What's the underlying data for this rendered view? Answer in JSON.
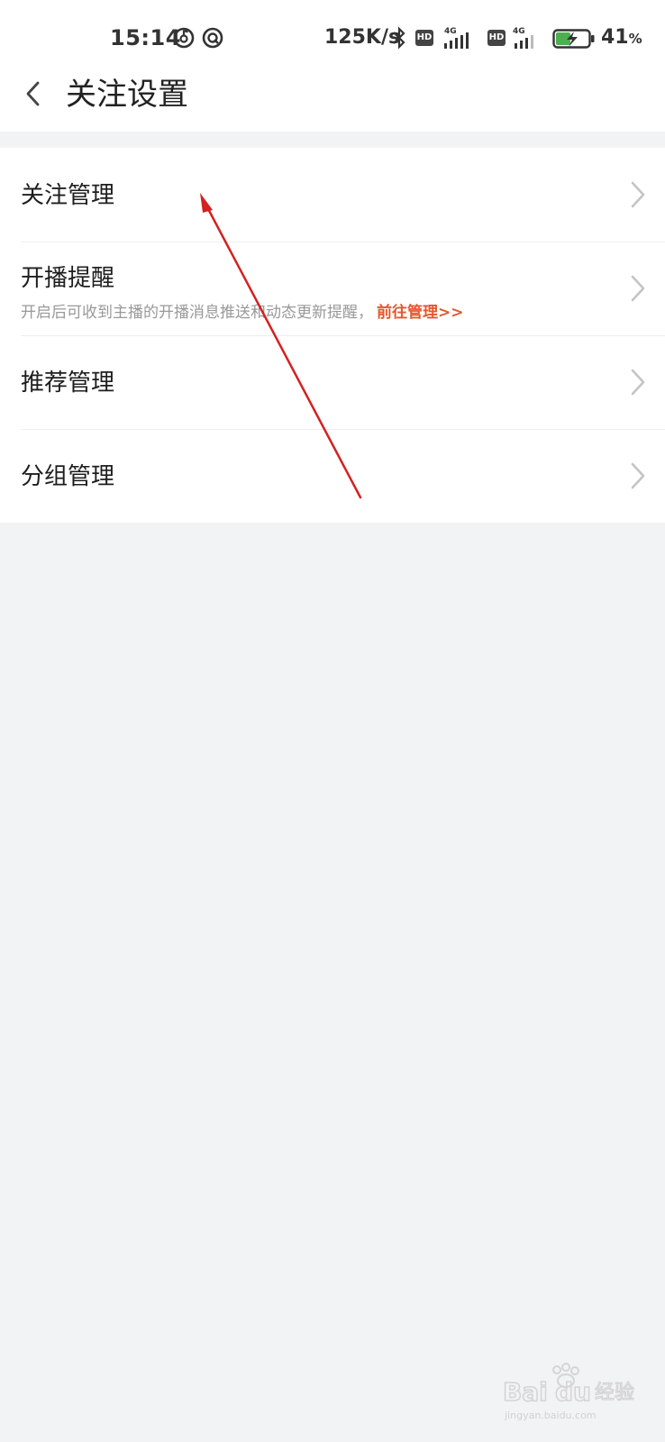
{
  "status_bar": {
    "time": "15:14",
    "net_speed": "125K/s",
    "hd_label": "HD",
    "network_label": "4G",
    "battery_level": "41",
    "battery_unit": "%"
  },
  "header": {
    "title": "关注设置"
  },
  "settings": {
    "items": [
      {
        "label": "关注管理"
      },
      {
        "label": "开播提醒",
        "subtitle": "开启后可收到主播的开播消息推送和动态更新提醒，",
        "link": "前往管理>>"
      },
      {
        "label": "推荐管理"
      },
      {
        "label": "分组管理"
      }
    ]
  },
  "colors": {
    "accent_link": "#e4572e",
    "annotation_arrow": "#d42020",
    "background": "#f1f3f4"
  },
  "watermark": {
    "brand": "Bai du 经验",
    "url": "jingyan.baidu.com"
  }
}
